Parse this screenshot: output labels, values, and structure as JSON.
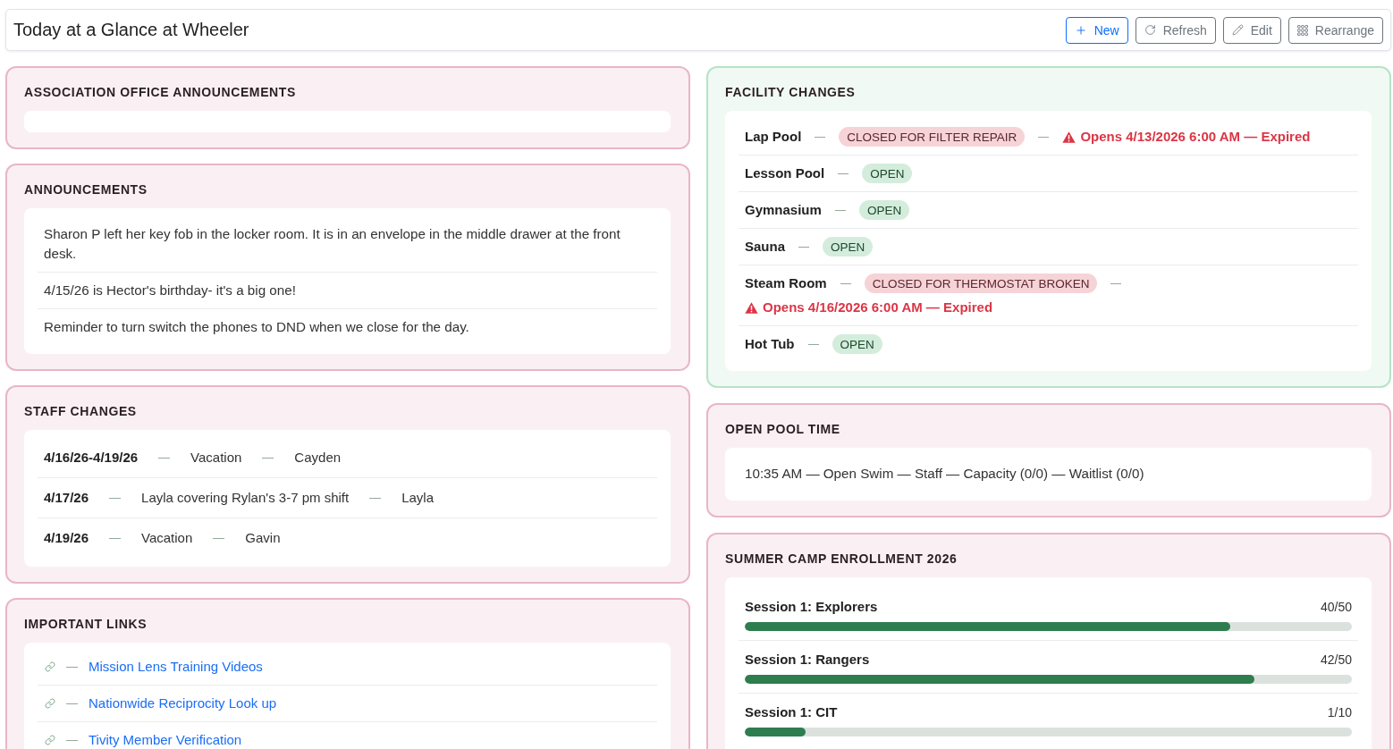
{
  "header": {
    "title": "Today at a Glance at Wheeler",
    "buttons": [
      {
        "label": "New",
        "primary": true
      },
      {
        "label": "Refresh",
        "primary": false
      },
      {
        "label": "Edit",
        "primary": false
      },
      {
        "label": "Rearrange",
        "primary": false
      }
    ]
  },
  "columns": [
    {
      "sections": [
        {
          "kind": "notes",
          "color": "#e9b6c5",
          "title": "ASSOCIATION OFFICE ANNOUNCEMENTS"
        },
        {
          "kind": "notes",
          "color": "#e9b6c5",
          "title": "ANNOUNCEMENTS",
          "items": [
            "Sharon P left her key fob in the locker room. It is in an envelope in the middle drawer at the front desk.",
            "4/15/26 is Hector's birthday- it's a big one!",
            "Reminder to turn switch the phones to DND when we close for the day."
          ]
        },
        {
          "kind": "staff",
          "color": "#e9b6c5",
          "title": "STAFF CHANGES",
          "rows": [
            {
              "date": "4/16/26-4/19/26",
              "change": "Vacation",
              "person": "Cayden"
            },
            {
              "date": "4/17/26",
              "change": "Layla covering Rylan's 3-7 pm shift",
              "person": "Layla"
            },
            {
              "date": "4/19/26",
              "change": "Vacation",
              "person": "Gavin"
            }
          ]
        },
        {
          "kind": "links",
          "color": "#e9b6c5",
          "title": "IMPORTANT LINKS",
          "links": [
            "Mission Lens Training Videos",
            "Nationwide Reciprocity Look up",
            "Tivity Member Verification"
          ]
        }
      ]
    },
    {
      "sections": [
        {
          "kind": "facility",
          "color": "#b7e3c7",
          "title": "FACILITY CHANGES",
          "rows": [
            {
              "name": "Lap Pool",
              "closed": true,
              "badge": "CLOSED FOR FILTER REPAIR",
              "notice": "Opens 4/13/2026 6:00 AM — Expired"
            },
            {
              "name": "Lesson Pool",
              "closed": false,
              "badge": "OPEN"
            },
            {
              "name": "Gymnasium",
              "closed": false,
              "badge": "OPEN"
            },
            {
              "name": "Sauna",
              "closed": false,
              "badge": "OPEN"
            },
            {
              "name": "Steam Room",
              "closed": true,
              "badge": "CLOSED FOR THERMOSTAT BROKEN",
              "notice": "Opens 4/16/2026 6:00 AM — Expired"
            },
            {
              "name": "Hot Tub",
              "closed": false,
              "badge": "OPEN"
            }
          ]
        },
        {
          "kind": "notes",
          "color": "#e9b6c5",
          "title": "OPEN POOL TIME",
          "items": [
            "10:35 AM — Open Swim — Staff — Capacity (0/0) — Waitlist (0/0)"
          ]
        },
        {
          "kind": "enrollment",
          "color": "#e9b6c5",
          "title": "SUMMER CAMP ENROLLMENT 2026",
          "sessions": [
            {
              "name": "Session 1: Explorers",
              "count": "40/50",
              "level": 0.8
            },
            {
              "name": "Session 1: Rangers",
              "count": "42/50",
              "level": 0.84
            },
            {
              "name": "Session 1: CIT",
              "count": "1/10",
              "level": 0.1
            }
          ]
        }
      ]
    }
  ]
}
